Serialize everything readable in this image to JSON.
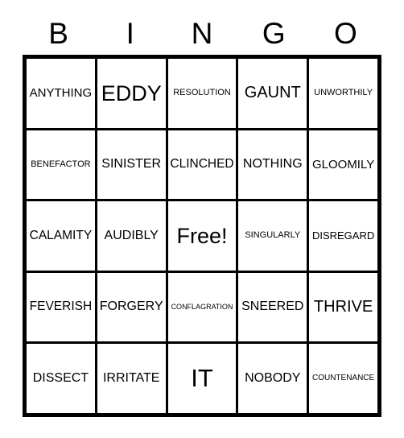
{
  "card": {
    "header_letters": [
      "B",
      "I",
      "N",
      "G",
      "O"
    ],
    "colors": {
      "background": "#ffffff",
      "ink": "#000000",
      "border": "#000000"
    },
    "grid": {
      "rows": 5,
      "columns": 5,
      "free_space_index": 12
    },
    "cells": [
      {
        "text": "ANYTHING",
        "size": "m",
        "free": false
      },
      {
        "text": "EDDY",
        "size": "xl",
        "free": false
      },
      {
        "text": "RESOLUTION",
        "size": "xs",
        "free": false
      },
      {
        "text": "GAUNT",
        "size": "l",
        "free": false
      },
      {
        "text": "UNWORTHILY",
        "size": "xs",
        "free": false
      },
      {
        "text": "BENEFACTOR",
        "size": "xs",
        "free": false
      },
      {
        "text": "SINISTER",
        "size": "m",
        "free": false
      },
      {
        "text": "CLINCHED",
        "size": "m",
        "free": false
      },
      {
        "text": "NOTHING",
        "size": "m",
        "free": false
      },
      {
        "text": "GLOOMILY",
        "size": "m",
        "free": false
      },
      {
        "text": "CALAMITY",
        "size": "m",
        "free": false
      },
      {
        "text": "AUDIBLY",
        "size": "m",
        "free": false
      },
      {
        "text": "Free!",
        "size": "xl",
        "free": true
      },
      {
        "text": "SINGULARLY",
        "size": "xs",
        "free": false
      },
      {
        "text": "DISREGARD",
        "size": "s",
        "free": false
      },
      {
        "text": "FEVERISH",
        "size": "m",
        "free": false
      },
      {
        "text": "FORGERY",
        "size": "m",
        "free": false
      },
      {
        "text": "CONFLAGRATION",
        "size": "xxs",
        "free": false
      },
      {
        "text": "SNEERED",
        "size": "m",
        "free": false
      },
      {
        "text": "THRIVE",
        "size": "l",
        "free": false
      },
      {
        "text": "DISSECT",
        "size": "m",
        "free": false
      },
      {
        "text": "IRRITATE",
        "size": "m",
        "free": false
      },
      {
        "text": "IT",
        "size": "xxl",
        "free": false
      },
      {
        "text": "NOBODY",
        "size": "m",
        "free": false
      },
      {
        "text": "COUNTENANCE",
        "size": "xs",
        "free": false
      }
    ]
  }
}
